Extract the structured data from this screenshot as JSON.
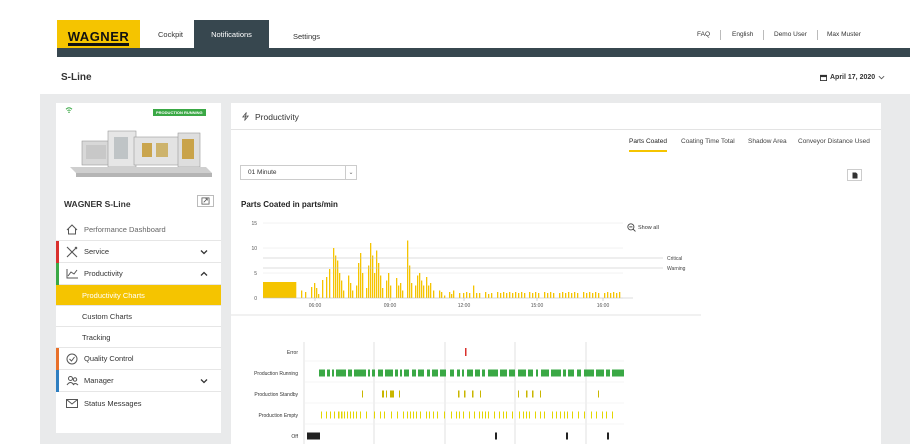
{
  "brand": {
    "logo_text": "WAGNER",
    "accent": "#f5c400",
    "nav_color": "#37474f"
  },
  "nav": {
    "tabs": [
      {
        "label": "Cockpit"
      },
      {
        "label": "Notifications",
        "active": true
      },
      {
        "label": "Settings"
      }
    ],
    "links": [
      {
        "label": "FAQ"
      },
      {
        "label": "English"
      },
      {
        "label": "Demo User"
      },
      {
        "label": "Max Muster"
      }
    ]
  },
  "page": {
    "title": "S-Line",
    "date": "April 17, 2020"
  },
  "machine": {
    "status_badge": "PRODUCTION RUNNING",
    "name": "WAGNER S-Line"
  },
  "sidebar": {
    "items": [
      {
        "label": "Performance Dashboard",
        "icon": "home-icon"
      },
      {
        "label": "Service",
        "icon": "tools-icon",
        "accent": "#d9302c",
        "expandable": true,
        "expanded": false
      },
      {
        "label": "Productivity",
        "icon": "chart-icon",
        "accent": "#3aa845",
        "expandable": true,
        "expanded": true
      },
      {
        "label": "Quality Control",
        "icon": "check-circle-icon",
        "accent": "#e8702a"
      },
      {
        "label": "Manager",
        "icon": "users-icon",
        "accent": "#2f7fc1",
        "expandable": true,
        "expanded": false
      },
      {
        "label": "Status Messages",
        "icon": "envelope-icon"
      }
    ],
    "subitems": [
      {
        "label": "Productivity Charts",
        "active": true
      },
      {
        "label": "Custom Charts"
      },
      {
        "label": "Tracking"
      }
    ]
  },
  "panel": {
    "title": "Productivity",
    "tabs": [
      {
        "label": "Parts Coated",
        "active": true
      },
      {
        "label": "Coating Time Total"
      },
      {
        "label": "Shadow Area"
      },
      {
        "label": "Conveyor Distance Used"
      }
    ],
    "interval": "01 Minute",
    "show_all": "Show all"
  },
  "chart_data": [
    {
      "type": "bar",
      "title": "Parts Coated in parts/min",
      "ylim": [
        0,
        15
      ],
      "yticks": [
        0,
        5,
        10,
        15
      ],
      "xticks": [
        "06:00",
        "09:00",
        "12:00",
        "15:00",
        "16:00"
      ],
      "thresholds": [
        {
          "name": "Critical",
          "value": 8
        },
        {
          "name": "Warning",
          "value": 6
        }
      ],
      "color": "#f5c400",
      "x_range": [
        0,
        360
      ],
      "x_tick_positions": [
        52,
        127,
        201,
        274,
        340
      ],
      "bars": [
        [
          0,
          3,
          3.2
        ],
        [
          3,
          3,
          3.2
        ],
        [
          6,
          3,
          3.2
        ],
        [
          9,
          3,
          3.2
        ],
        [
          12,
          3,
          3.2
        ],
        [
          15,
          3,
          3.2
        ],
        [
          18,
          3,
          3.2
        ],
        [
          21,
          3,
          3.2
        ],
        [
          24,
          3,
          3.2
        ],
        [
          27,
          3,
          3.2
        ],
        [
          30,
          3,
          3.2
        ],
        [
          38,
          1,
          1.5
        ],
        [
          42,
          1,
          1.2
        ],
        [
          48,
          1,
          2.2
        ],
        [
          51,
          1,
          3.0
        ],
        [
          53,
          1,
          2.0
        ],
        [
          55,
          1,
          0.8
        ],
        [
          59,
          1,
          3.6
        ],
        [
          63,
          1,
          4.2
        ],
        [
          66,
          1,
          5.8
        ],
        [
          70,
          1,
          10.0
        ],
        [
          72,
          1,
          8.5
        ],
        [
          74,
          1,
          7.5
        ],
        [
          76,
          1,
          5.0
        ],
        [
          78,
          1,
          3.5
        ],
        [
          80,
          1,
          1.5
        ],
        [
          85,
          1,
          4.5
        ],
        [
          87,
          1,
          3.0
        ],
        [
          89,
          1,
          1.5
        ],
        [
          93,
          1,
          2.5
        ],
        [
          95,
          1,
          7.0
        ],
        [
          97,
          1,
          9.0
        ],
        [
          99,
          1,
          5.0
        ],
        [
          103,
          1,
          2.0
        ],
        [
          105,
          1,
          6.5
        ],
        [
          107,
          1,
          11.0
        ],
        [
          109,
          1,
          8.5
        ],
        [
          111,
          1,
          5.0
        ],
        [
          113,
          1,
          9.5
        ],
        [
          115,
          1,
          7.0
        ],
        [
          117,
          1,
          4.5
        ],
        [
          119,
          1,
          2.0
        ],
        [
          123,
          1,
          3.5
        ],
        [
          125,
          1,
          5.0
        ],
        [
          127,
          1,
          2.5
        ],
        [
          133,
          1,
          4.0
        ],
        [
          135,
          1,
          2.5
        ],
        [
          137,
          1,
          3.0
        ],
        [
          139,
          1,
          1.5
        ],
        [
          144,
          1,
          11.5
        ],
        [
          146,
          1,
          6.5
        ],
        [
          148,
          1,
          3.0
        ],
        [
          152,
          1,
          2.5
        ],
        [
          154,
          1,
          4.5
        ],
        [
          156,
          1,
          5.0
        ],
        [
          158,
          1,
          3.5
        ],
        [
          160,
          1,
          2.5
        ],
        [
          163,
          1,
          4.2
        ],
        [
          165,
          1,
          2.5
        ],
        [
          167,
          1,
          3.0
        ],
        [
          170,
          1,
          1.5
        ],
        [
          176,
          1,
          1.5
        ],
        [
          178,
          1,
          1.2
        ],
        [
          181,
          1,
          0.5
        ],
        [
          186,
          1,
          1.2
        ],
        [
          188,
          1,
          0.8
        ],
        [
          190,
          1,
          1.5
        ],
        [
          196,
          1,
          1.0
        ],
        [
          200,
          1,
          1.0
        ],
        [
          203,
          1,
          1.2
        ],
        [
          206,
          1,
          1.0
        ],
        [
          210,
          1,
          2.5
        ],
        [
          213,
          1,
          1.0
        ],
        [
          216,
          1,
          1.0
        ],
        [
          222,
          1,
          1.2
        ],
        [
          225,
          1,
          0.8
        ],
        [
          228,
          1,
          1.0
        ],
        [
          234,
          1,
          1.2
        ],
        [
          237,
          1,
          1.0
        ],
        [
          240,
          1,
          1.2
        ],
        [
          243,
          1,
          1.0
        ],
        [
          246,
          1,
          1.2
        ],
        [
          249,
          1,
          1.0
        ],
        [
          252,
          1,
          1.2
        ],
        [
          255,
          1,
          1.0
        ],
        [
          258,
          1,
          1.2
        ],
        [
          261,
          1,
          1.0
        ],
        [
          266,
          1,
          1.2
        ],
        [
          269,
          1,
          1.0
        ],
        [
          272,
          1,
          1.2
        ],
        [
          275,
          1,
          1.0
        ],
        [
          281,
          1,
          1.2
        ],
        [
          284,
          1,
          1.0
        ],
        [
          287,
          1,
          1.2
        ],
        [
          290,
          1,
          1.0
        ],
        [
          296,
          1,
          1.0
        ],
        [
          299,
          1,
          1.2
        ],
        [
          302,
          1,
          1.0
        ],
        [
          305,
          1,
          1.2
        ],
        [
          308,
          1,
          1.0
        ],
        [
          311,
          1,
          1.2
        ],
        [
          314,
          1,
          1.0
        ],
        [
          320,
          1,
          1.2
        ],
        [
          323,
          1,
          1.0
        ],
        [
          326,
          1,
          1.2
        ],
        [
          329,
          1,
          1.0
        ],
        [
          332,
          1,
          1.2
        ],
        [
          335,
          1,
          1.0
        ],
        [
          341,
          1,
          1.0
        ],
        [
          344,
          1,
          1.2
        ],
        [
          347,
          1,
          1.0
        ],
        [
          350,
          1,
          1.2
        ],
        [
          353,
          1,
          1.0
        ],
        [
          356,
          1,
          1.2
        ]
      ]
    },
    {
      "type": "timeline",
      "x_range": [
        0,
        320
      ],
      "lanes": [
        {
          "name": "Error",
          "color": "#d9302c",
          "segments": [
            [
              161,
              1.5
            ]
          ]
        },
        {
          "name": "Production Running",
          "color": "#3aa845",
          "segments": [
            [
              15,
              6
            ],
            [
              23,
              3
            ],
            [
              28,
              2
            ],
            [
              32,
              10
            ],
            [
              44,
              4
            ],
            [
              50,
              12
            ],
            [
              64,
              2
            ],
            [
              68,
              3
            ],
            [
              74,
              5
            ],
            [
              81,
              8
            ],
            [
              91,
              3
            ],
            [
              96,
              2
            ],
            [
              100,
              5
            ],
            [
              108,
              4
            ],
            [
              114,
              6
            ],
            [
              123,
              3
            ],
            [
              128,
              6
            ],
            [
              136,
              6
            ],
            [
              146,
              4
            ],
            [
              153,
              3
            ],
            [
              158,
              2
            ],
            [
              163,
              6
            ],
            [
              171,
              5
            ],
            [
              178,
              3
            ],
            [
              184,
              10
            ],
            [
              196,
              7
            ],
            [
              205,
              6
            ],
            [
              214,
              8
            ],
            [
              224,
              5
            ],
            [
              232,
              2
            ],
            [
              237,
              8
            ],
            [
              247,
              10
            ],
            [
              259,
              3
            ],
            [
              264,
              6
            ],
            [
              273,
              4
            ],
            [
              280,
              10
            ],
            [
              292,
              8
            ],
            [
              302,
              4
            ],
            [
              308,
              12
            ]
          ]
        },
        {
          "name": "Production Standby",
          "color": "#c9b600",
          "segments": [
            [
              58,
              1
            ],
            [
              78,
              2
            ],
            [
              82,
              1
            ],
            [
              86,
              4
            ],
            [
              95,
              1
            ],
            [
              154,
              1.5
            ],
            [
              160,
              1.5
            ],
            [
              168,
              1.5
            ],
            [
              176,
              1
            ],
            [
              214,
              1
            ],
            [
              222,
              1.5
            ],
            [
              228,
              1.5
            ],
            [
              236,
              1
            ],
            [
              294,
              1
            ]
          ]
        },
        {
          "name": "Production Empty",
          "color": "#e3d600",
          "segments": [
            [
              17,
              1
            ],
            [
              22,
              1
            ],
            [
              26,
              1
            ],
            [
              30,
              1
            ],
            [
              34,
              1.5
            ],
            [
              37,
              1.5
            ],
            [
              40,
              1
            ],
            [
              43,
              1
            ],
            [
              46,
              1
            ],
            [
              49,
              1
            ],
            [
              52,
              1
            ],
            [
              56,
              1
            ],
            [
              62,
              1
            ],
            [
              70,
              1
            ],
            [
              76,
              1
            ],
            [
              80,
              1
            ],
            [
              87,
              1
            ],
            [
              93,
              1
            ],
            [
              99,
              1
            ],
            [
              103,
              1
            ],
            [
              106,
              1
            ],
            [
              109,
              1
            ],
            [
              112,
              1
            ],
            [
              116,
              1
            ],
            [
              122,
              1
            ],
            [
              125,
              1
            ],
            [
              129,
              1
            ],
            [
              133,
              1
            ],
            [
              140,
              1
            ],
            [
              147,
              1
            ],
            [
              152,
              1
            ],
            [
              155,
              1
            ],
            [
              159,
              1
            ],
            [
              165,
              1
            ],
            [
              170,
              1
            ],
            [
              175,
              1
            ],
            [
              178,
              1
            ],
            [
              181,
              1
            ],
            [
              184,
              1
            ],
            [
              190,
              1
            ],
            [
              195,
              1
            ],
            [
              199,
              1
            ],
            [
              202,
              1
            ],
            [
              208,
              1
            ],
            [
              215,
              1
            ],
            [
              219,
              1
            ],
            [
              222,
              1
            ],
            [
              225,
              1
            ],
            [
              231,
              1
            ],
            [
              236,
              1
            ],
            [
              240,
              1
            ],
            [
              248,
              1
            ],
            [
              252,
              1
            ],
            [
              256,
              1
            ],
            [
              260,
              1
            ],
            [
              263,
              1
            ],
            [
              268,
              1
            ],
            [
              274,
              1
            ],
            [
              280,
              1
            ],
            [
              287,
              1
            ],
            [
              292,
              1
            ],
            [
              298,
              1
            ],
            [
              302,
              1
            ],
            [
              308,
              1
            ]
          ]
        },
        {
          "name": "Off",
          "color": "#222222",
          "segments": [
            [
              3,
              13
            ],
            [
              191,
              2
            ],
            [
              262,
              2
            ],
            [
              303,
              2
            ]
          ]
        }
      ]
    }
  ]
}
